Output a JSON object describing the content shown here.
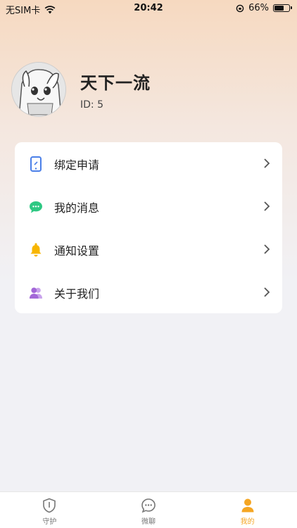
{
  "status_bar": {
    "carrier": "无SIM卡",
    "time": "20:42",
    "battery": "66%",
    "battery_level": 0.66
  },
  "profile": {
    "name": "天下一流",
    "id_text": "ID: 5"
  },
  "menu": [
    {
      "label": "绑定申请",
      "icon": "phone-link-icon",
      "color": "#4a7fe8"
    },
    {
      "label": "我的消息",
      "icon": "chat-bubble-icon",
      "color": "#2ec883"
    },
    {
      "label": "通知设置",
      "icon": "bell-icon",
      "color": "#f7b500"
    },
    {
      "label": "关于我们",
      "icon": "users-icon",
      "color": "#a367d8"
    }
  ],
  "tabs": [
    {
      "label": "守护",
      "icon": "shield-icon",
      "active": false
    },
    {
      "label": "微聊",
      "icon": "chat-icon",
      "active": false
    },
    {
      "label": "我的",
      "icon": "person-icon",
      "active": true
    }
  ],
  "colors": {
    "accent": "#f5a623",
    "tab_inactive": "#777777"
  }
}
